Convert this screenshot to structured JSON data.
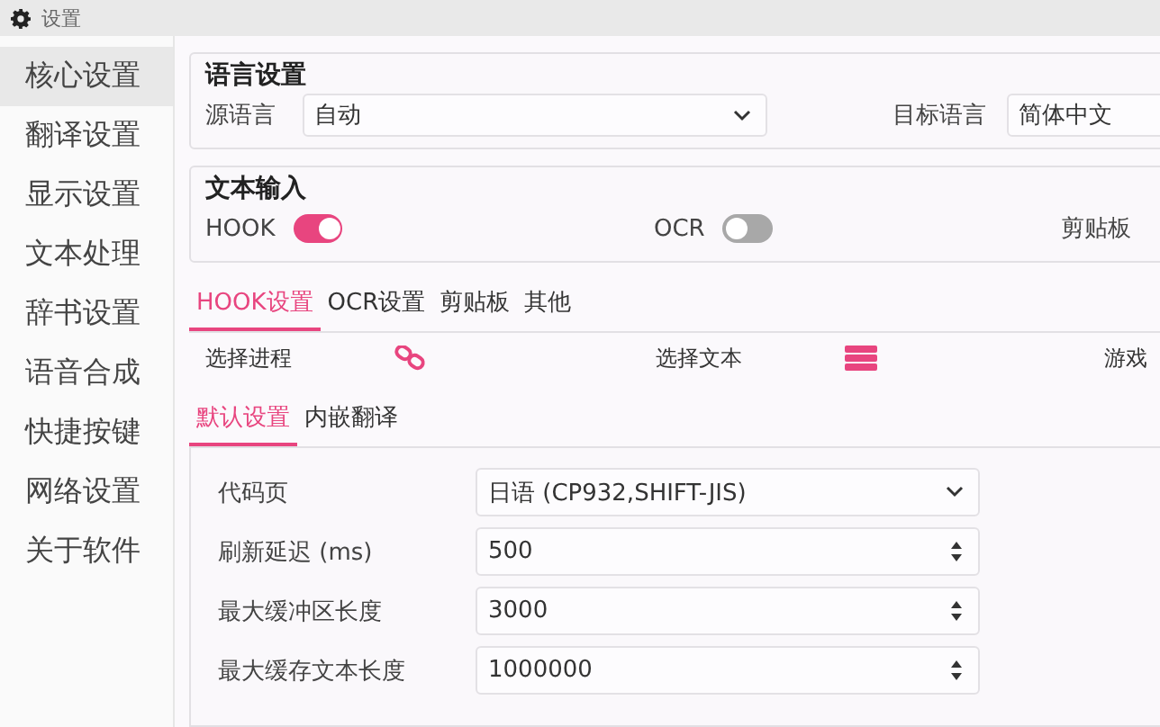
{
  "window": {
    "title": "设置"
  },
  "sidebar": {
    "items": [
      {
        "label": "核心设置",
        "selected": true
      },
      {
        "label": "翻译设置",
        "selected": false
      },
      {
        "label": "显示设置",
        "selected": false
      },
      {
        "label": "文本处理",
        "selected": false
      },
      {
        "label": "辞书设置",
        "selected": false
      },
      {
        "label": "语音合成",
        "selected": false
      },
      {
        "label": "快捷按键",
        "selected": false
      },
      {
        "label": "网络设置",
        "selected": false
      },
      {
        "label": "关于软件",
        "selected": false
      }
    ]
  },
  "language_settings": {
    "title": "语言设置",
    "source": {
      "label": "源语言",
      "value": "自动"
    },
    "target": {
      "label": "目标语言",
      "value": "简体中文"
    }
  },
  "text_input": {
    "title": "文本输入",
    "options": [
      {
        "label": "HOOK",
        "kind": "toggle",
        "on": true
      },
      {
        "label": "OCR",
        "kind": "toggle",
        "on": false
      },
      {
        "label": "剪贴板",
        "kind": "label"
      }
    ]
  },
  "tabs": [
    {
      "label": "HOOK设置",
      "selected": true
    },
    {
      "label": "OCR设置",
      "selected": false
    },
    {
      "label": "剪贴板",
      "selected": false
    },
    {
      "label": "其他",
      "selected": false
    }
  ],
  "actions": [
    {
      "label": "选择进程",
      "kind": "link"
    },
    {
      "label": "选择文本",
      "kind": "list"
    },
    {
      "label": "游戏",
      "kind": "none"
    }
  ],
  "subtabs": [
    {
      "label": "默认设置",
      "selected": true
    },
    {
      "label": "内嵌翻译",
      "selected": false
    }
  ],
  "fields": [
    {
      "label": "代码页",
      "kind": "select",
      "value": "日语 (CP932,SHIFT-JIS)"
    },
    {
      "label": "刷新延迟 (ms)",
      "kind": "spin",
      "value": "500"
    },
    {
      "label": "最大缓冲区长度",
      "kind": "spin",
      "value": "3000"
    },
    {
      "label": "最大缓存文本长度",
      "kind": "spin",
      "value": "1000000"
    }
  ]
}
